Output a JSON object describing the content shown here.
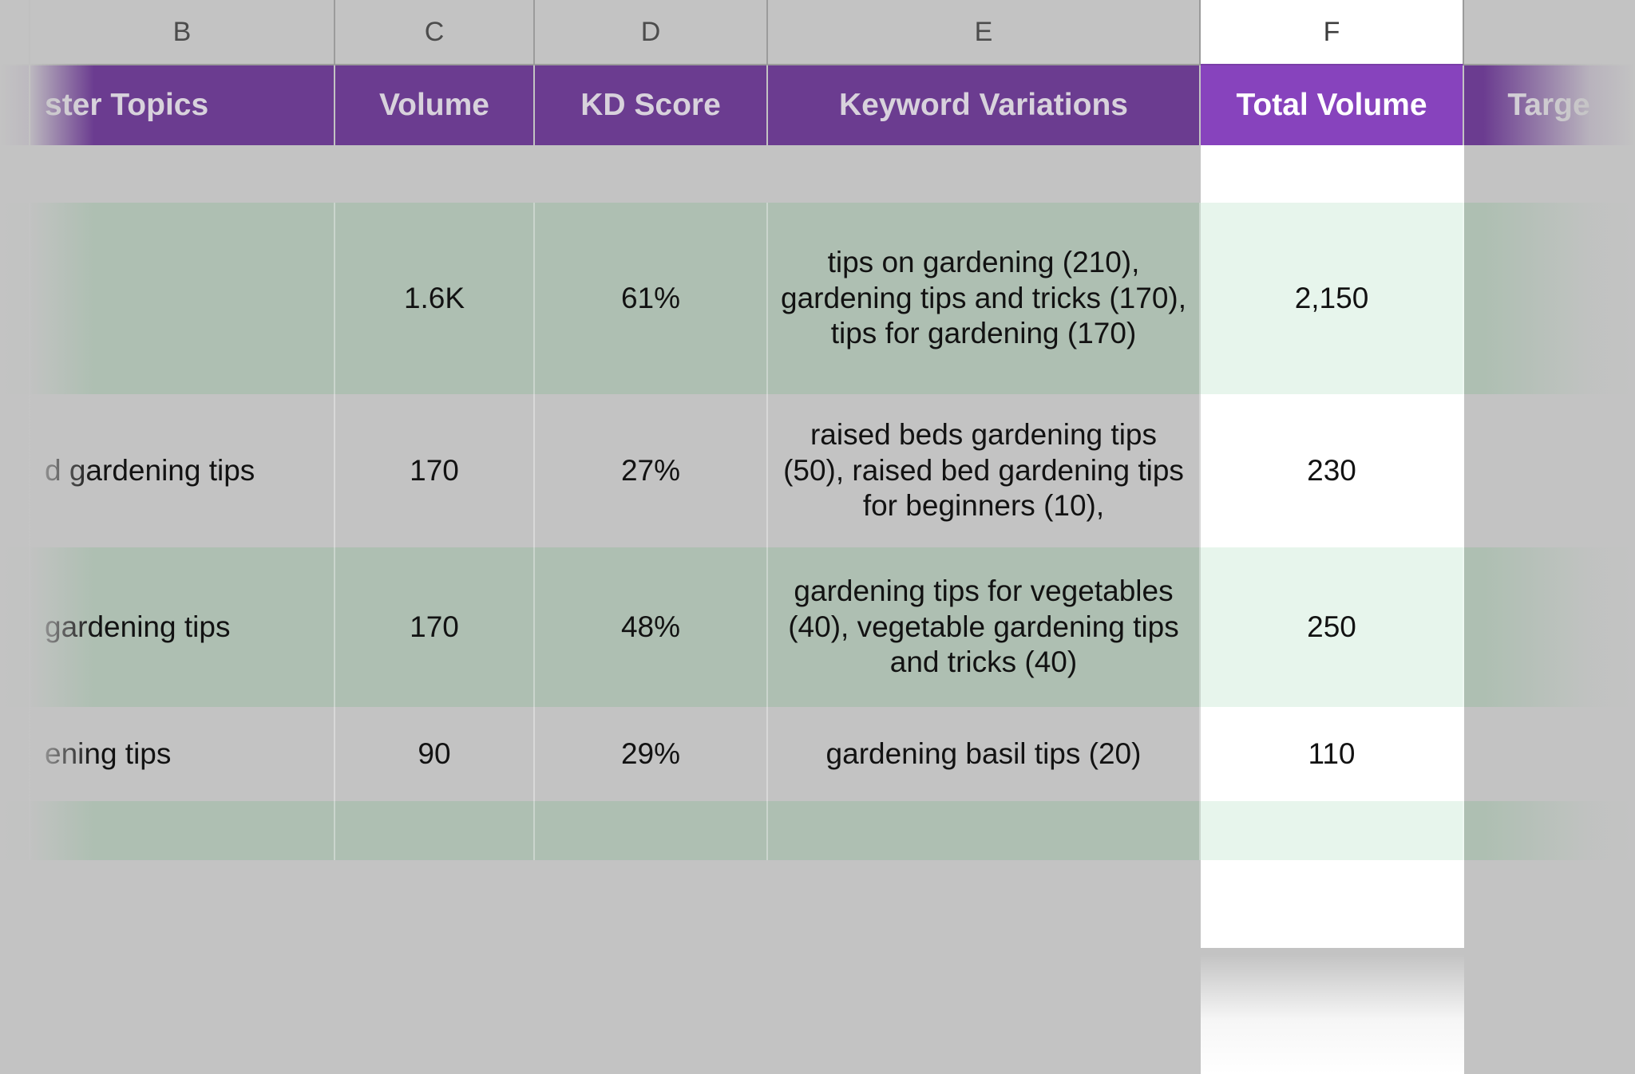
{
  "spreadsheet": {
    "column_headers": [
      "",
      "B",
      "C",
      "D",
      "E",
      "F",
      ""
    ],
    "selected_column": "F",
    "accent_purple": "#6b3c90",
    "selected_purple": "#8743bd",
    "striped_row_color": "#aebfb2",
    "selected_cell_striped": "#e7f5ec",
    "background": "#c3c3c3"
  },
  "table": {
    "headers": {
      "a": "",
      "b": "ster Topics",
      "c": "Volume",
      "d": "KD Score",
      "e": "Keyword Variations",
      "f": "Total Volume",
      "g": "Targe"
    },
    "rows": [
      {
        "b": "",
        "c": "1.6K",
        "d": "61%",
        "e": "tips on gardening (210), gardening tips and tricks (170), tips for gardening (170)",
        "f": "2,150",
        "g": ""
      },
      {
        "b": "d gardening tips",
        "c": "170",
        "d": "27%",
        "e": "raised beds gardening tips (50), raised bed gardening tips for beginners (10),",
        "f": "230",
        "g": ""
      },
      {
        "b": "gardening tips",
        "c": "170",
        "d": "48%",
        "e": "gardening tips for vegetables (40), vegetable gardening tips and tricks (40)",
        "f": "250",
        "g": ""
      },
      {
        "b": "ening tips",
        "c": "90",
        "d": "29%",
        "e": "gardening basil tips (20)",
        "f": "110",
        "g": ""
      },
      {
        "b": "",
        "c": "",
        "d": "",
        "e": "",
        "f": "",
        "g": ""
      }
    ]
  }
}
